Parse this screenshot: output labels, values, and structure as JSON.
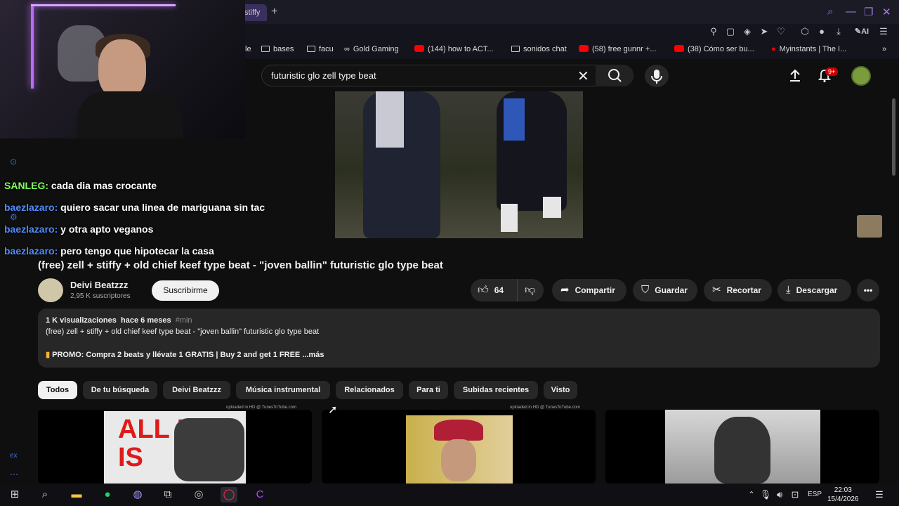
{
  "browser": {
    "active_tab_label": "stiffy",
    "new_tab_icon": "plus-icon",
    "bookmarks": [
      {
        "label": "le",
        "type": "text"
      },
      {
        "label": "bases",
        "type": "folder"
      },
      {
        "label": "facu",
        "type": "folder"
      },
      {
        "label": "Gold Gaming",
        "type": "site"
      },
      {
        "label": "(144) how to ACT...",
        "type": "youtube"
      },
      {
        "label": "sonidos chat",
        "type": "folder"
      },
      {
        "label": "(58) free gunnr +...",
        "type": "youtube"
      },
      {
        "label": "(38) Cómo ser bu...",
        "type": "youtube"
      },
      {
        "label": "Myinstants | The I...",
        "type": "site"
      }
    ],
    "ai_label": "AI"
  },
  "header": {
    "search_query": "futuristic glo zell type beat",
    "notification_badge": "9+"
  },
  "chat": [
    {
      "user": "SANLEG:",
      "message": "cada dia mas crocante",
      "color": "#7dff5b"
    },
    {
      "user": "baezlazaro:",
      "message": "quiero sacar una linea de mariguana sin tac",
      "color": "#4f8cff"
    },
    {
      "user": "baezlazaro:",
      "message": "y otra apto veganos",
      "color": "#4f8cff"
    },
    {
      "user": "baezlazaro:",
      "message": "pero tengo que hipotecar la casa",
      "color": "#4f8cff"
    }
  ],
  "video": {
    "title": "(free) zell + stiffy + old chief keef type beat - \"joven ballin\" futuristic glo type beat",
    "channel_name": "Deivi Beatzzz",
    "subscribers": "2,95 K suscriptores",
    "subscribe_label": "Suscribirme",
    "likes": "64",
    "share_label": "Compartir",
    "save_label": "Guardar",
    "clip_label": "Recortar",
    "download_label": "Descargar"
  },
  "description": {
    "views": "1 K visualizaciones",
    "age": "hace 6 meses",
    "hashtag": "#min",
    "line1": "(free) zell + stiffy + old chief keef type beat - \"joven ballin\" futuristic glo type beat",
    "promo": "PROMO: Compra 2 beats y llévate 1 GRATIS | Buy 2 and get 1 FREE",
    "more": "...más"
  },
  "chips": [
    "Todos",
    "De tu búsqueda",
    "Deivi Beatzzz",
    "Música instrumental",
    "Relacionados",
    "Para ti",
    "Subidas recientes",
    "Visto"
  ],
  "thumbnails": [
    {
      "hd_label": "uploaded in HD @ TunesToTube.com",
      "overlay": "ALL I DO IS"
    },
    {
      "hd_label": "uploaded in HD @ TunesToTube.com",
      "overlay": ""
    },
    {
      "hd_label": "",
      "overlay": ""
    }
  ],
  "taskbar": {
    "language": "ESP",
    "time": "22:03",
    "date": "15/4/2026"
  },
  "colors": {
    "accent_purple": "#b96df5",
    "youtube_red": "#ff0000",
    "chat_green": "#7dff5b",
    "chat_blue": "#4f8cff"
  }
}
